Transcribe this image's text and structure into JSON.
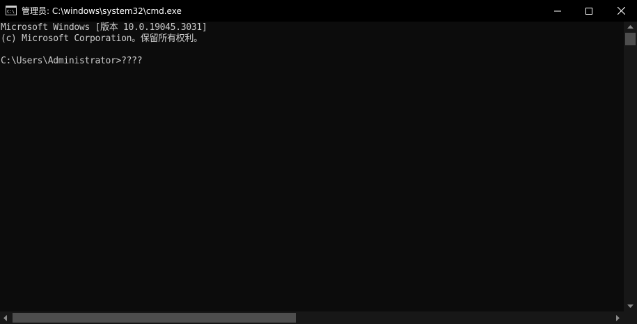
{
  "window": {
    "title": "管理员: C:\\windows\\system32\\cmd.exe",
    "app_icon": "cmd-icon"
  },
  "controls": {
    "minimize_icon": "minimize-icon",
    "maximize_icon": "maximize-icon",
    "close_icon": "close-icon"
  },
  "console": {
    "lines": [
      "Microsoft Windows [版本 10.0.19045.3031]",
      "(c) Microsoft Corporation。保留所有权利。",
      "",
      "C:\\Users\\Administrator>????"
    ]
  },
  "colors": {
    "background": "#0c0c0c",
    "foreground": "#cccccc",
    "titlebar": "#000000",
    "scroll_track": "#171717",
    "scroll_thumb": "#4d4d4d"
  }
}
